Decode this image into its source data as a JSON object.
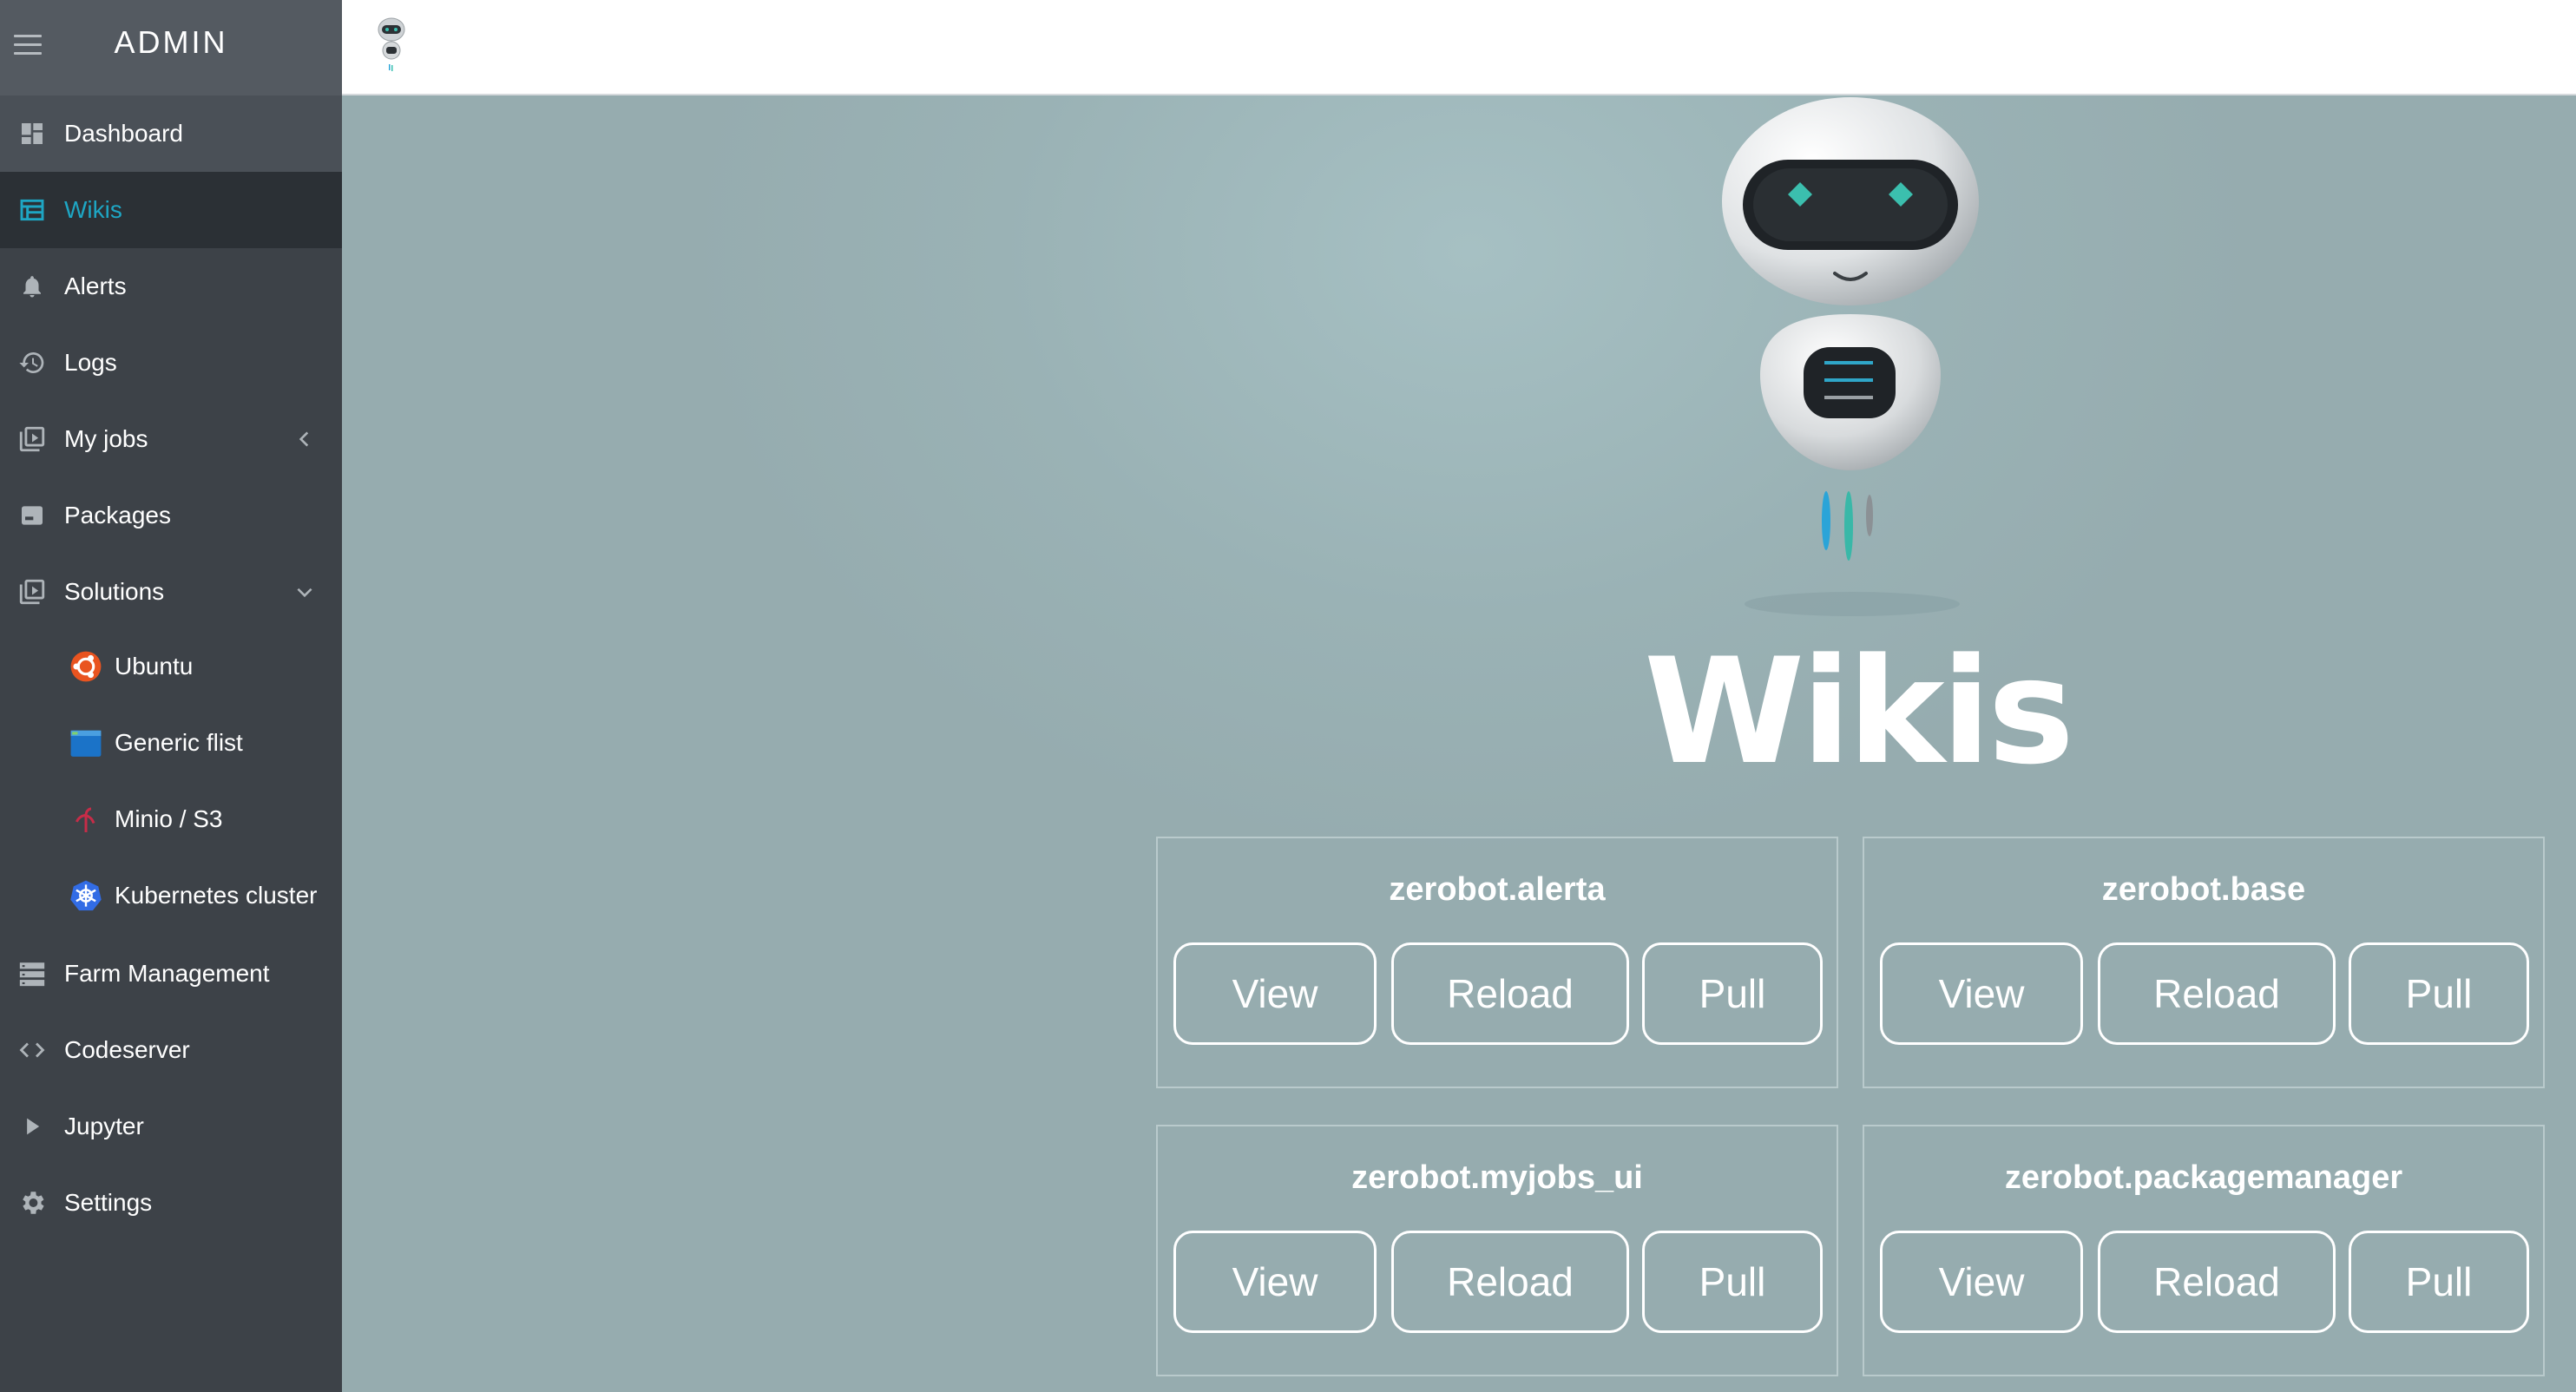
{
  "sidebar": {
    "title": "ADMIN",
    "items": [
      {
        "label": "Dashboard",
        "icon": "dashboard-icon"
      },
      {
        "label": "Wikis",
        "icon": "wikis-icon",
        "active": true
      },
      {
        "label": "Alerts",
        "icon": "bell-icon"
      },
      {
        "label": "Logs",
        "icon": "history-icon"
      },
      {
        "label": "My jobs",
        "icon": "jobs-icon"
      },
      {
        "label": "Packages",
        "icon": "package-icon"
      },
      {
        "label": "Solutions",
        "icon": "solutions-icon"
      },
      {
        "label": "Ubuntu",
        "icon": "ubuntu-icon"
      },
      {
        "label": "Generic flist",
        "icon": "flist-icon"
      },
      {
        "label": "Minio / S3",
        "icon": "minio-icon"
      },
      {
        "label": "Kubernetes cluster",
        "icon": "kubernetes-icon"
      },
      {
        "label": "Farm Management",
        "icon": "server-icon"
      },
      {
        "label": "Codeserver",
        "icon": "code-icon"
      },
      {
        "label": "Jupyter",
        "icon": "play-icon"
      },
      {
        "label": "Settings",
        "icon": "gear-icon"
      }
    ]
  },
  "main": {
    "title": "Wikis",
    "wikis": [
      {
        "name": "zerobot.alerta",
        "view": "View",
        "reload": "Reload",
        "pull": "Pull"
      },
      {
        "name": "zerobot.base",
        "view": "View",
        "reload": "Reload",
        "pull": "Pull"
      },
      {
        "name": "zerobot.myjobs_ui",
        "view": "View",
        "reload": "Reload",
        "pull": "Pull"
      },
      {
        "name": "zerobot.packagemanager",
        "view": "View",
        "reload": "Reload",
        "pull": "Pull"
      }
    ]
  },
  "colors": {
    "sidebar_bg": "#3d4248",
    "sidebar_header_bg": "#545a61",
    "active_item_bg": "#2b3035",
    "accent": "#1ea6c4",
    "main_bg": "#9fb6b9",
    "ubuntu": "#e95420",
    "kubernetes": "#326ce5",
    "minio": "#c72c48"
  }
}
